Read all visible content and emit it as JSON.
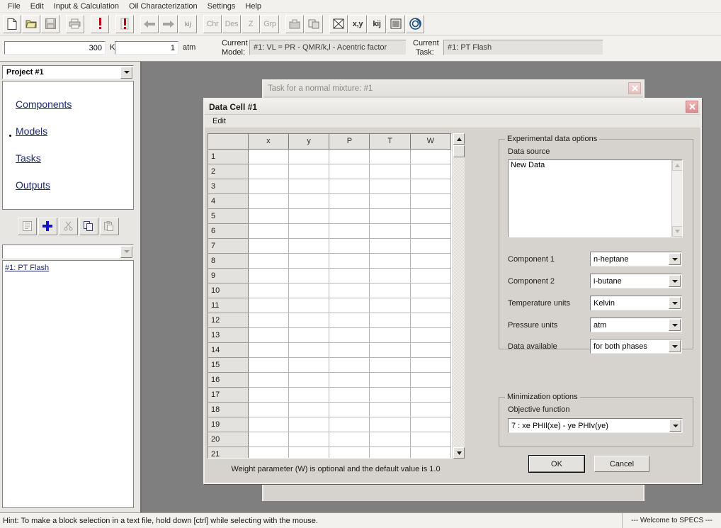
{
  "menu": {
    "items": [
      {
        "label": "File"
      },
      {
        "label": "Edit"
      },
      {
        "label": "Input & Calculation"
      },
      {
        "label": "Oil Characterization"
      },
      {
        "label": "Settings"
      },
      {
        "label": "Help"
      }
    ]
  },
  "toolbar": {
    "buttons": [
      {
        "name": "new-file-icon",
        "label": "",
        "enabled": true
      },
      {
        "name": "open-folder-icon",
        "label": "",
        "enabled": true
      },
      {
        "name": "save-disk-icon",
        "label": "",
        "enabled": false
      },
      {
        "name": "print-icon",
        "label": "",
        "enabled": false
      },
      {
        "name": "run-calc-icon",
        "label": "",
        "enabled": true
      },
      {
        "name": "run-calc-thermometer-icon",
        "label": "",
        "enabled": true
      },
      {
        "name": "back-arrow-icon",
        "label": "",
        "enabled": false
      },
      {
        "name": "forward-arrow-icon",
        "label": "",
        "enabled": false
      },
      {
        "name": "kij-matrix-icon",
        "label": "kij",
        "enabled": false
      },
      {
        "name": "chr-button",
        "label": "Chr",
        "enabled": false
      },
      {
        "name": "des-button",
        "label": "Des",
        "enabled": false
      },
      {
        "name": "z-button",
        "label": "Z",
        "enabled": false
      },
      {
        "name": "grp-button",
        "label": "Grp",
        "enabled": false
      },
      {
        "name": "export-icon",
        "label": "",
        "enabled": false
      },
      {
        "name": "copy-window-icon",
        "label": "",
        "enabled": false
      },
      {
        "name": "plot-icon",
        "label": "",
        "enabled": true
      },
      {
        "name": "xy-plot-button",
        "label": "x,y",
        "enabled": true
      },
      {
        "name": "kij-plot-button",
        "label": "kij",
        "enabled": true
      },
      {
        "name": "matrix-plot-icon",
        "label": "",
        "enabled": true
      },
      {
        "name": "about-icon",
        "label": "",
        "enabled": true
      }
    ]
  },
  "params": {
    "temperature_value": "300",
    "temperature_unit": "Kelvin",
    "pressure_value": "1",
    "pressure_unit": "atm",
    "current_model_label_line1": "Current",
    "current_model_label_line2": "Model:",
    "current_model_value": "#1:  VL = PR - QMR/k,l - Acentric factor",
    "current_task_label_line1": "Current",
    "current_task_label_line2": "Task:",
    "current_task_value": "#1:  PT Flash"
  },
  "project_panel": {
    "project_selector_value": "Project #1",
    "nav_items": [
      {
        "label": "Components",
        "selected": false
      },
      {
        "label": "Models",
        "selected": false
      },
      {
        "label": "Tasks",
        "selected": true
      },
      {
        "label": "Outputs",
        "selected": false
      }
    ],
    "action_buttons": [
      {
        "name": "edit-list-icon",
        "enabled": false
      },
      {
        "name": "add-plus-icon",
        "enabled": true
      },
      {
        "name": "cut-scissors-icon",
        "enabled": false
      },
      {
        "name": "copy-icon",
        "enabled": true
      },
      {
        "name": "paste-icon",
        "enabled": false
      }
    ],
    "filter_combo_value": "",
    "task_list": [
      {
        "label": "#1:  PT Flash"
      }
    ]
  },
  "task_window": {
    "title": "Task for a normal mixture:  #1"
  },
  "dialog": {
    "title": "Data Cell #1",
    "menu": [
      {
        "label": "Edit"
      }
    ],
    "grid": {
      "columns": [
        "",
        "x",
        "y",
        "P",
        "T",
        "W"
      ],
      "rows": [
        "1",
        "2",
        "3",
        "4",
        "5",
        "6",
        "7",
        "8",
        "9",
        "10",
        "11",
        "12",
        "13",
        "14",
        "15",
        "16",
        "17",
        "18",
        "19",
        "20",
        "21"
      ]
    },
    "grid_hint": "Weight parameter (W) is optional and the default value is 1.0",
    "experimental_group": {
      "title": "Experimental data options",
      "data_source_label": "Data source",
      "data_source_items": [
        "New Data"
      ],
      "fields": [
        {
          "label": "Component 1",
          "value": "n-heptane"
        },
        {
          "label": "Component 2",
          "value": "i-butane"
        },
        {
          "label": "Temperature units",
          "value": "Kelvin"
        },
        {
          "label": "Pressure units",
          "value": "atm"
        },
        {
          "label": "Data available",
          "value": "for both phases"
        }
      ]
    },
    "minimization_group": {
      "title": "Minimization options",
      "objective_label": "Objective function",
      "objective_value": "7 :  xe PHIl(xe) - ye PHIv(ye)"
    },
    "ok_label": "OK",
    "cancel_label": "Cancel"
  },
  "statusbar": {
    "hint": "Hint: To make a block selection in a text file, hold down [ctrl] while selecting with the mouse.",
    "welcome": "--- Welcome to SPECS ---"
  }
}
